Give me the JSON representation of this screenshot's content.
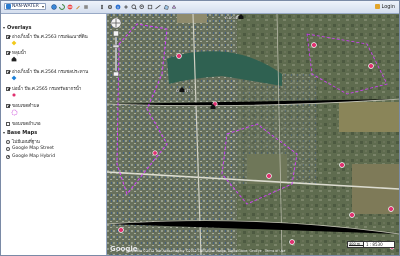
{
  "toolbar": {
    "brand_label": "NAN-WATER",
    "login_label": "Login",
    "icons": [
      "globe-icon",
      "refresh-icon",
      "no-entry-icon",
      "edit-icon",
      "tools-icon",
      "pan-icon",
      "settings-icon",
      "info-icon",
      "navigate-icon",
      "zoom-in-icon",
      "zoom-out-icon",
      "full-extent-icon",
      "measure-icon",
      "area-icon",
      "polygon-icon"
    ]
  },
  "sidebar": {
    "overlays_title": "Overlays",
    "layers": [
      {
        "label": "อ่างเก็บน้ำ ปีพ.ศ.2563 กรมพัฒนาที่ดิน",
        "checked": true,
        "legend_color": "#f2c91a",
        "legend": "diamond"
      },
      {
        "label": "หลุมน้ำ",
        "checked": true,
        "legend_color": "#222222",
        "legend": "house"
      },
      {
        "label": "อ่างเก็บน้ำ ปีพ.ศ.2564 กรมชลประทาน",
        "checked": true,
        "legend_color": "#1a7fd8",
        "legend": "diamond"
      },
      {
        "label": "บ่อน้ำ ปีพ.ศ.2565 กรมทรัพยากรน้ำ",
        "checked": true,
        "legend_color": "#e0306f",
        "legend": "dot"
      },
      {
        "label": "ขอบเขตตำบล",
        "checked": true,
        "legend_color": "#c22ad4",
        "legend": "dashed-ring"
      },
      {
        "label": "ขอบเขตอำเภอ",
        "checked": false,
        "legend_color": "",
        "legend": "none"
      }
    ],
    "basemaps_title": "Base Maps",
    "basemaps": [
      {
        "label": "ไม่มีแผนที่ฐาน",
        "selected": false
      },
      {
        "label": "Google Map Street",
        "selected": false
      },
      {
        "label": "Google Map Hybrid",
        "selected": true
      }
    ]
  },
  "map": {
    "copyright": "Map data ©2012 Tele Atlas imagery ©2012 CNES/Spot Image, DigitalGlobe, GeoEye - Terms of Use",
    "scale_label": "400 m",
    "ratio_label": "1 : 8530",
    "place_labels": [
      "ต.ม่วงตึ๊ด",
      "บ้านพร้าว"
    ],
    "marker_color": "#e0306f",
    "boundary_color": "#d23cff"
  }
}
